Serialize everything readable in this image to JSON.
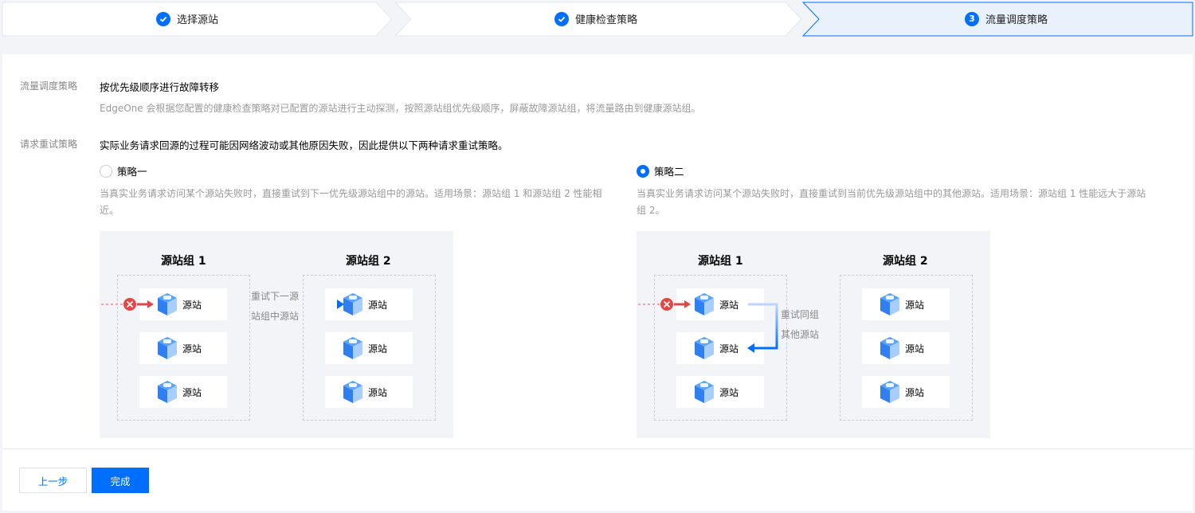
{
  "steps": [
    {
      "label": "选择源站",
      "state": "done"
    },
    {
      "label": "健康检查策略",
      "state": "done"
    },
    {
      "number": "3",
      "label": "流量调度策略",
      "state": "active"
    }
  ],
  "schedule": {
    "label": "流量调度策略",
    "value": "按优先级顺序进行故障转移",
    "desc": "EdgeOne 会根据您配置的健康检查策略对已配置的源站进行主动探测，按照源站组优先级顺序，屏蔽故障源站组，将流量路由到健康源站组。"
  },
  "retry": {
    "label": "请求重试策略",
    "value": "实际业务请求回源的过程可能因网络波动或其他原因失败，因此提供以下两种请求重试策略。",
    "options": [
      {
        "label": "策略一",
        "selected": false,
        "desc": "当真实业务请求访问某个源站失败时，直接重试到下一优先级源站组中的源站。适用场景：源站组 1 和源站组 2 性能相近。",
        "group1": "源站组 1",
        "group2": "源站组 2",
        "node_label": "源站",
        "annotation_line1": "重试下一源",
        "annotation_line2": "站组中源站"
      },
      {
        "label": "策略二",
        "selected": true,
        "desc": "当真实业务请求访问某个源站失败时，直接重试到当前优先级源站组中的其他源站。适用场景：源站组 1 性能远大于源站组 2。",
        "group1": "源站组 1",
        "group2": "源站组 2",
        "node_label": "源站",
        "annotation_line1": "重试同组",
        "annotation_line2": "其他源站"
      }
    ]
  },
  "footer": {
    "prev_label": "上一步",
    "done_label": "完成"
  },
  "colors": {
    "primary": "#006eff",
    "error": "#e54545",
    "active_step_bg": "#e9f1fd"
  },
  "icons": [
    "check-circle-icon",
    "server-cube-icon",
    "error-x-icon",
    "arrow-right-icon"
  ]
}
